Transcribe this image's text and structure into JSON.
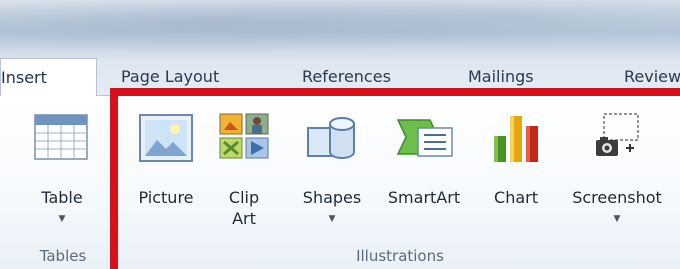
{
  "tabs": [
    "Insert",
    "Page Layout",
    "References",
    "Mailings",
    "Review"
  ],
  "groups": {
    "tables": {
      "label": "Tables",
      "buttons": [
        {
          "label": "Table",
          "has_dropdown": true,
          "icon": "table-icon"
        }
      ]
    },
    "illustrations": {
      "label": "Illustrations",
      "buttons": [
        {
          "label": "Picture",
          "icon": "picture-icon"
        },
        {
          "label": "Clip\nArt",
          "line1": "Clip",
          "line2": "Art",
          "icon": "clip-art-icon"
        },
        {
          "label": "Shapes",
          "has_dropdown": true,
          "icon": "shapes-icon"
        },
        {
          "label": "SmartArt",
          "icon": "smartart-icon"
        },
        {
          "label": "Chart",
          "icon": "chart-icon"
        },
        {
          "label": "Screenshot",
          "has_dropdown": true,
          "icon": "screenshot-icon"
        }
      ]
    }
  },
  "colors": {
    "highlight": "#d8101c",
    "ribbon_text": "#1f2a38",
    "group_label": "#5b6b7e"
  }
}
